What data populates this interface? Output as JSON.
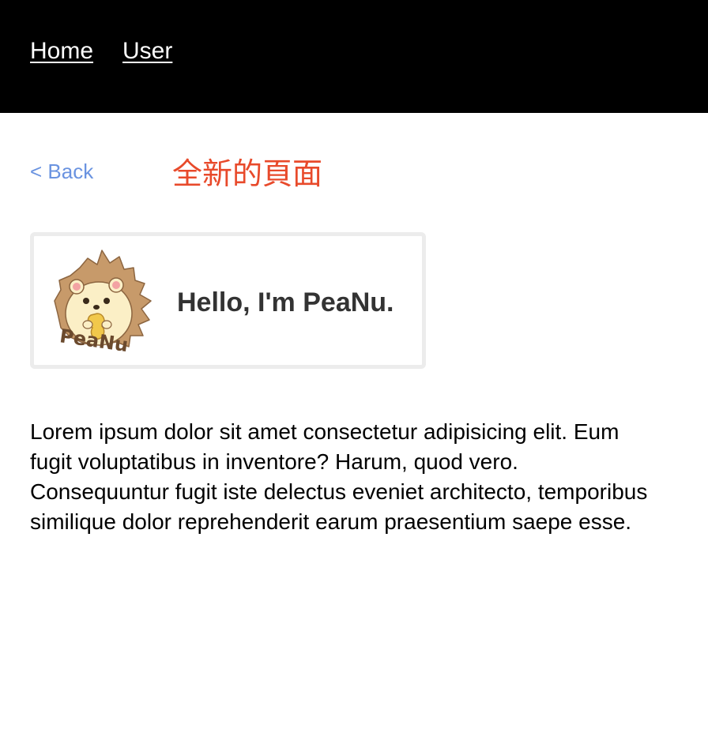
{
  "nav": {
    "items": [
      {
        "label": "Home"
      },
      {
        "label": "User"
      }
    ]
  },
  "header": {
    "back_label": "< Back",
    "title": "全新的頁面"
  },
  "card": {
    "title": "Hello, I'm PeaNu.",
    "avatar_icon": "hedgehog-avatar-icon",
    "avatar_text": "PeaNu"
  },
  "content": {
    "paragraph": "Lorem ipsum dolor sit amet consectetur adipisicing elit. Eum fugit voluptatibus in inventore? Harum, quod vero. Consequuntur fugit iste delectus eveniet architecto, temporibus similique dolor reprehenderit earum praesentium saepe esse."
  },
  "colors": {
    "topbar": "#000000",
    "back_link": "#6a93e0",
    "page_title": "#e84a2b",
    "card_border": "#ececec",
    "card_title": "#333333"
  }
}
